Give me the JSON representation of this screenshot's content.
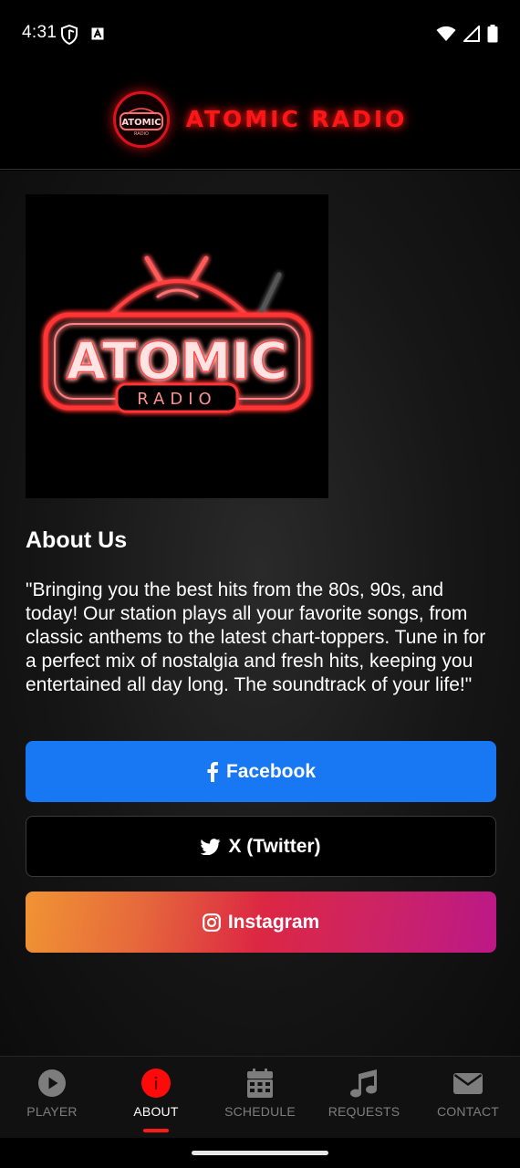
{
  "status_bar": {
    "time": "4:31"
  },
  "header": {
    "title": "ATOMIC RADIO",
    "logo_text": "ATOMIC",
    "logo_subtext": "RADIO"
  },
  "hero": {
    "art_title": "ATOMIC",
    "art_subtitle": "RADIO"
  },
  "about": {
    "title": "About Us",
    "text": "\"Bringing you the best hits from the 80s, 90s, and today! Our station plays all your favorite songs, from classic anthems to the latest chart-toppers. Tune in for a perfect mix of nostalgia and fresh hits, keeping you entertained all day long. The soundtrack of your life!\""
  },
  "social": {
    "facebook": {
      "label": "Facebook",
      "icon": "facebook-icon",
      "color": "#1877f2"
    },
    "twitter": {
      "label": "X (Twitter)",
      "icon": "twitter-icon",
      "color": "#000000"
    },
    "instagram": {
      "label": "Instagram",
      "icon": "instagram-icon",
      "gradient": [
        "#f09433",
        "#dc2743",
        "#bc1888"
      ]
    }
  },
  "nav": {
    "items": [
      {
        "label": "PLAYER",
        "icon": "play-circle-icon",
        "active": false
      },
      {
        "label": "ABOUT",
        "icon": "info-icon",
        "active": true
      },
      {
        "label": "SCHEDULE",
        "icon": "calendar-icon",
        "active": false
      },
      {
        "label": "REQUESTS",
        "icon": "music-note-icon",
        "active": false
      },
      {
        "label": "CONTACT",
        "icon": "envelope-icon",
        "active": false
      }
    ]
  },
  "colors": {
    "accent": "#ff1515",
    "background": "#000000",
    "nav_inactive": "#7d7d7d"
  }
}
